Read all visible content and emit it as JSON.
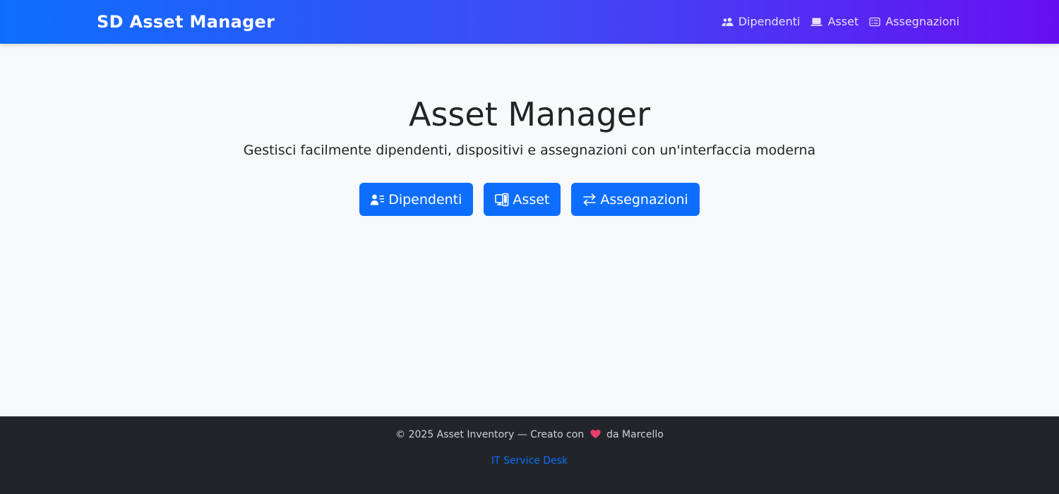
{
  "navbar": {
    "brand": "SD Asset Manager",
    "links": [
      {
        "label": "Dipendenti",
        "icon": "people-icon"
      },
      {
        "label": "Asset",
        "icon": "laptop-icon"
      },
      {
        "label": "Assegnazioni",
        "icon": "card-list-icon"
      }
    ]
  },
  "hero": {
    "title": "Asset Manager",
    "subtitle": "Gestisci facilmente dipendenti, dispositivi e assegnazioni con un'interfaccia moderna",
    "buttons": [
      {
        "label": "Dipendenti",
        "icon": "person-lines-icon"
      },
      {
        "label": "Asset",
        "icon": "devices-icon"
      },
      {
        "label": "Assegnazioni",
        "icon": "arrow-left-right-icon"
      }
    ]
  },
  "footer": {
    "text_before_heart": "© 2025 Asset Inventory — Creato con",
    "text_after_heart": "da Marcello",
    "heart_icon": "heart-icon",
    "link_label": "IT Service Desk"
  },
  "colors": {
    "primary": "#0d6efd",
    "navbar_gradient_start": "#0d6efd",
    "navbar_gradient_end": "#6610f2",
    "footer_bg": "#212529",
    "page_bg": "#f8f9fa",
    "heart": "#e83e6c"
  }
}
